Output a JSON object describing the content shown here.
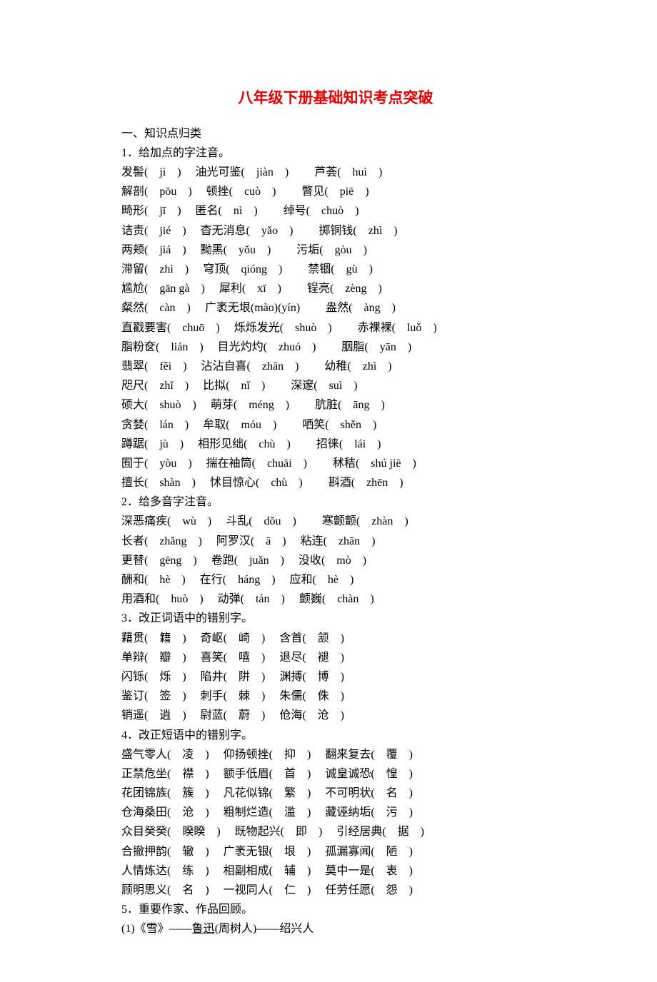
{
  "title": "八年级下册基础知识考点突破",
  "section1_header": "一、知识点归类",
  "q1_header": "1．给加点的字注音。",
  "q1_lines": [
    "发髻(　jì　)　 油光可鉴(　jiàn　)　　 芦荟(　huì　)",
    "解剖(　pōu　)　 顿挫(　cuò　)　　 瞥见(　piē　)",
    "畸形(　jī　)　 匿名(　nì　)　　 绰号(　chuò　)",
    "诘责(　jié　)　 杳无消息(　yǎo　)　　 掷铜钱(　zhì　)",
    "两颊(　jiá　)　 黝黑(　yǒu　)　　 污垢(　gòu　)",
    "滞留(　zhì　)　 穹顶(　qióng　)　　 禁锢(　gù　)",
    "尴尬(　gān gà　)　 犀利(　xī　)　　 锃亮(　zèng　)",
    "粲然(　càn　)　 广袤无垠(mào)(yín)　　 盎然(　àng　)",
    "直戳要害(　chuō　)　 烁烁发光(　shuò　)　　 赤裸裸(　luǒ　)",
    "脂粉奁(　lián　)　 目光灼灼(　zhuó　)　　 胭脂(　yān　)",
    "翡翠(　fěi　)　 沾沾自喜(　zhān　)　　 幼稚(　zhì　)",
    "咫尺(　zhǐ　)　 比拟(　nǐ　)　　 深邃(　suì　)",
    "硕大(　shuò　)　 萌芽(　méng　)　　 肮脏(　āng　)",
    "贪婪(　lán　)　 牟取(　móu　)　　 哂笑(　shěn　)",
    "蹲踞(　jù　)　 相形见绌(　chù　)　　 招徕(　lái　)",
    "囿于(　yòu　)　 揣在袖筒(　chuāi　)　　 秫秸(　shú jiē　)",
    "擅长(　shàn　)　 怵目惊心(　chù　)　　 斟酒(　zhēn　)"
  ],
  "q2_header": "2．给多音字注音。",
  "q2_lines": [
    "深恶痛疾(　wù　)　 斗乱(　dǒu　)　　 寒颤颤(　zhàn　)",
    "长者(　zhǎng　)　 阿罗汉(　ā　)　 粘连(　zhān　)",
    "更替(　gēng　)　 卷跑(　juǎn　)　 没收(　mò　)",
    "酬和(　hè　)　 在行(　háng　)　 应和(　hè　)",
    "用酒和(　huò　)　 动弹(　tán　)　 颤巍(　chàn　)"
  ],
  "q3_header": "3．改正词语中的错别字。",
  "q3_lines": [
    "藉贯(　籍　)　 奇岖(　崎　)　 含首(　颔　)",
    "单辩(　瓣　)　 喜笑(　嘻　)　 退尽(　褪　)",
    "闪铄(　烁　)　 陷井(　阱　)　 渊搏(　博　)",
    "鉴订(　签　)　 刺手(　棘　)　 朱儒(　侏　)",
    "销遥(　逍　)　 尉蓝(　蔚　)　 伧海(　沧　)"
  ],
  "q4_header": "4．改正短语中的错别字。",
  "q4_lines": [
    "盛气零人(　凌　)　 仰扬顿挫(　抑　)　 翻来复去(　覆　)",
    "正禁危坐(　襟　)　 额手低眉(　首　)　 诚皇诚恐(　惶　)",
    "花团锦族(　簇　)　 凡花似锦(　繁　)　 不可明状(　名　)",
    "仓海桑田(　沧　)　 粗制烂造(　滥　)　 藏诬纳垢(　污　)",
    "众目癸癸(　睽睽　)　 既物起兴(　即　)　 引经居典(　据　)",
    "合撤押韵(　辙　)　 广袤无银(　垠　)　 孤漏寡闻(　陋　)",
    "人情炼达(　练　)　 相副相成(　辅　)　 莫中一是(　衷　)",
    "顾明思义(　名　)　 一视同人(　仁　)　 任劳任愿(　怨　)"
  ],
  "q5_header": "5．重要作家、作品回顾。",
  "q5_item1_prefix": "(1)《雪》——",
  "q5_item1_author": "鲁迅",
  "q5_item1_suffix": "(周树人)——绍兴人"
}
